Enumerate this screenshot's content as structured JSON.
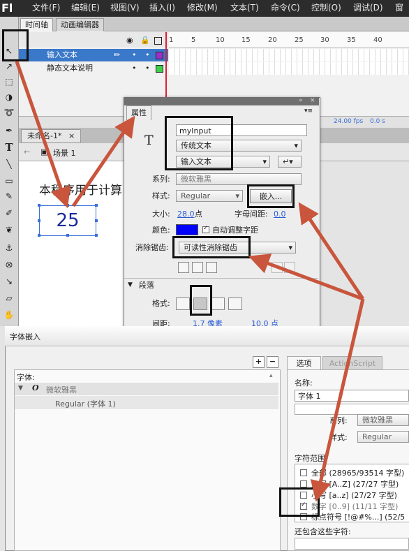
{
  "menubar": {
    "logo": "Fl",
    "items": [
      "文件(F)",
      "编辑(E)",
      "视图(V)",
      "插入(I)",
      "修改(M)",
      "文本(T)",
      "命令(C)",
      "控制(O)",
      "调试(D)",
      "窗"
    ]
  },
  "timeline": {
    "tabs": [
      "时间轴",
      "动画编辑器"
    ],
    "frame_numbers": [
      "1",
      "5",
      "10",
      "15",
      "20",
      "25",
      "30",
      "35",
      "40"
    ],
    "layers": [
      "输入文本",
      "静态文本说明"
    ],
    "fps": "24.00 fps",
    "time": "0.0 s"
  },
  "document": {
    "tab_label": "未命名-1*",
    "scene": "场景 1",
    "stage_text": "本程序用于计算",
    "textbox_value": "25"
  },
  "properties": {
    "tab": "属性",
    "instance_name": "myInput",
    "text_engine": "传统文本",
    "text_type": "输入文本",
    "family_label": "系列:",
    "family": "微软雅黑",
    "style_label": "样式:",
    "style": "Regular",
    "embed_button": "嵌入...",
    "size_label": "大小:",
    "size": "28.0",
    "size_unit": "点",
    "letter_spacing_label": "字母间距:",
    "letter_spacing": "0.0",
    "color_label": "颜色:",
    "text_color": "#0000ff",
    "auto_kern": "自动调整字距",
    "aa_label": "消除锯齿:",
    "aa_value": "可读性消除锯齿",
    "paragraph_section": "段落",
    "format_label": "格式:",
    "spacing_label": "间距:",
    "spacing_value": "1.7 像素",
    "leading_value": "10.0 点"
  },
  "embed_dialog": {
    "title": "字体嵌入",
    "font_header": "字体:",
    "font_family": "微软雅黑",
    "font_style": "Regular (字体 1)",
    "tabs": [
      "选项",
      "ActionScript"
    ],
    "name_label": "名称:",
    "name_value": "字体 1",
    "family_label": "系列:",
    "family_value": "微软雅黑",
    "style_label": "样式:",
    "style_value": "Regular",
    "range_label": "字符范围:",
    "ranges": [
      {
        "label": "全部",
        "count": "(28965/93514 字型)",
        "checked": false
      },
      {
        "label": "大写 [A..Z]",
        "count": "(27/27 字型)",
        "checked": false
      },
      {
        "label": "小写 [a..z]",
        "count": "(27/27 字型)",
        "checked": false
      },
      {
        "label": "数字 [0..9]",
        "count": "(11/11 字型)",
        "checked": true
      },
      {
        "label": "标点符号 [!@#%...]",
        "count": "(52/5",
        "checked": false
      }
    ],
    "include_label": "还包含这些字符:"
  },
  "colors": {
    "arrow": "#c8553c",
    "selection": "#3a6fd8",
    "layer_selected": "#3a78c9"
  }
}
